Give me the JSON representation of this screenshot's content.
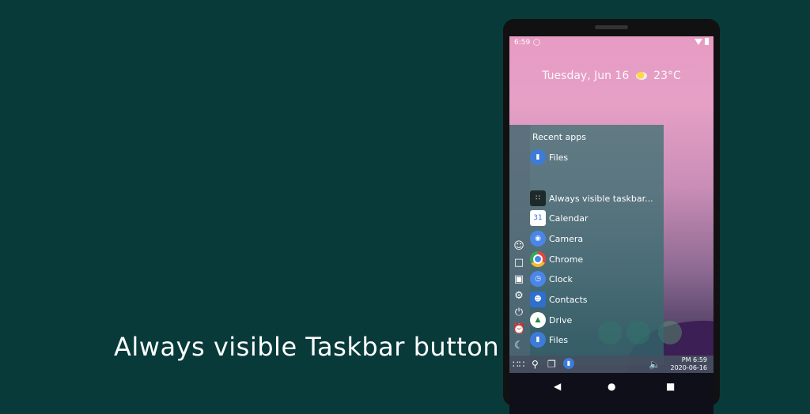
{
  "caption": "Always visible Taskbar button",
  "status": {
    "time": "6:59"
  },
  "date_widget": {
    "date": "Tuesday, Jun 16",
    "temp": "23°C"
  },
  "drawer": {
    "recent_title": "Recent apps",
    "recent": [
      {
        "label": "Files",
        "color": "#3d7bd9"
      }
    ],
    "apps": [
      {
        "label": "Always visible taskbar...",
        "color": "#1e2a2a",
        "icon": "grid-icon"
      },
      {
        "label": "Calendar",
        "color": "#ffffff",
        "icon": "calendar-icon"
      },
      {
        "label": "Camera",
        "color": "#4a86e8",
        "icon": "camera-icon"
      },
      {
        "label": "Chrome",
        "color": "#e8453c",
        "icon": "chrome-icon"
      },
      {
        "label": "Clock",
        "color": "#4a86e8",
        "icon": "clock-icon"
      },
      {
        "label": "Contacts",
        "color": "#2f6fce",
        "icon": "contacts-icon"
      },
      {
        "label": "Drive",
        "color": "#ffffff",
        "icon": "drive-icon"
      },
      {
        "label": "Files",
        "color": "#3d7bd9",
        "icon": "folder-icon"
      }
    ],
    "side_icons": [
      "user-icon",
      "folder-icon",
      "image-icon",
      "gear-icon",
      "power-icon",
      "alarm-icon",
      "moon-icon"
    ]
  },
  "taskbar": {
    "time": "PM 6:59",
    "date": "2020-06-16"
  },
  "calendar_day": "31"
}
